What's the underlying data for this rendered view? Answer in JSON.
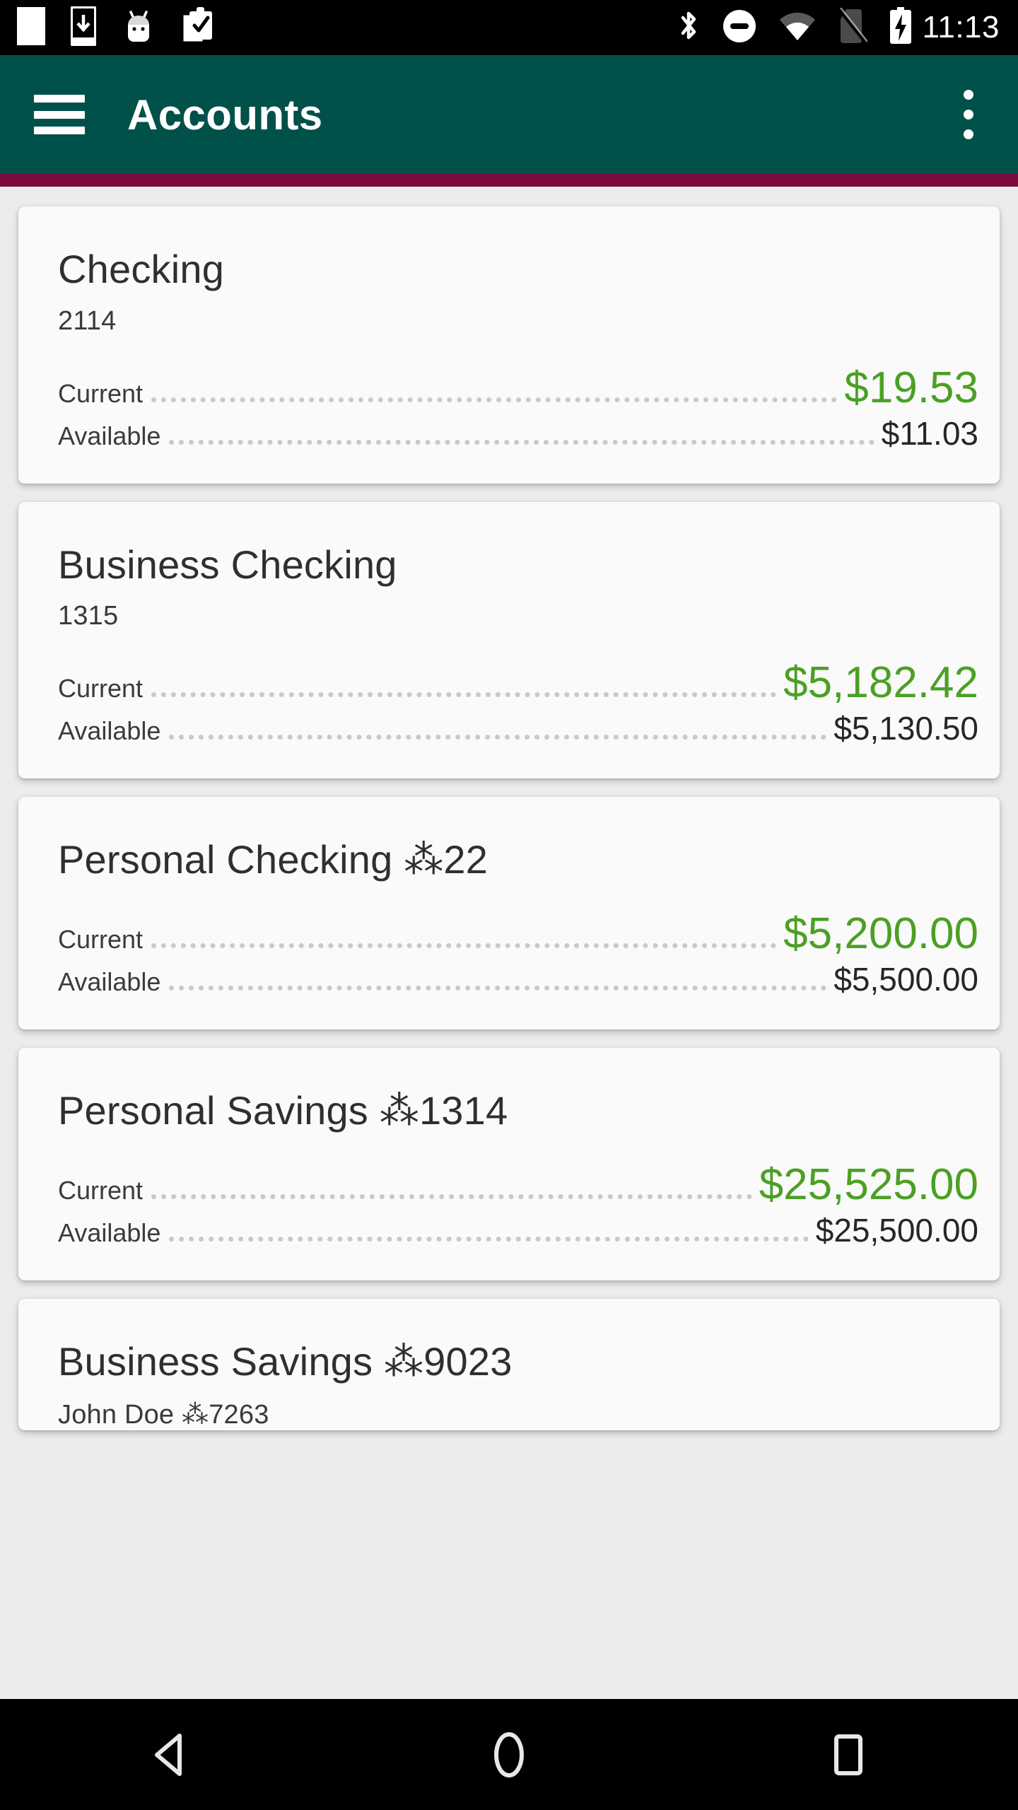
{
  "status_bar": {
    "time": "11:13",
    "left_icons": [
      "blank-notification-icon",
      "download-to-phone-icon",
      "android-mascot-icon",
      "clipboard-check-icon"
    ],
    "right_icons": [
      "bluetooth-icon",
      "do-not-disturb-icon",
      "wifi-icon",
      "no-sim-icon",
      "battery-charging-icon"
    ]
  },
  "app_bar": {
    "title": "Accounts",
    "menu_icon": "hamburger-menu-icon",
    "overflow_icon": "more-vertical-icon",
    "background_color": "#00514a",
    "accent_color": "#7a0b3a"
  },
  "colors": {
    "page_background": "#ececec",
    "card_background": "#fafafa",
    "current_balance": "#4ba024",
    "available_balance": "#262626",
    "leader_dots": "#c9c9c9"
  },
  "labels": {
    "current": "Current",
    "available": "Available"
  },
  "accounts": [
    {
      "name": "Checking",
      "sub": "2114",
      "current": "$19.53",
      "available": "$11.03",
      "clipped": false
    },
    {
      "name": "Business Checking",
      "sub": "1315",
      "current": "$5,182.42",
      "available": "$5,130.50",
      "clipped": false
    },
    {
      "name": "Personal Checking ⁂22",
      "sub": "",
      "current": "$5,200.00",
      "available": "$5,500.00",
      "clipped": false
    },
    {
      "name": "Personal Savings ⁂1314",
      "sub": "",
      "current": "$25,525.00",
      "available": "$25,500.00",
      "clipped": false
    },
    {
      "name": "Business Savings ⁂9023",
      "sub": "John Doe ⁂7263",
      "current": "",
      "available": "",
      "clipped": true
    }
  ],
  "nav_bar": {
    "back_label": "back-button",
    "home_label": "home-button",
    "recents_label": "recents-button"
  }
}
